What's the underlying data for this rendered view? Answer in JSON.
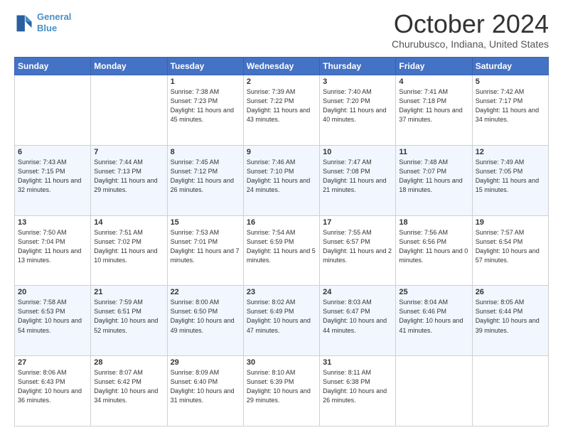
{
  "header": {
    "logo_line1": "General",
    "logo_line2": "Blue",
    "month_title": "October 2024",
    "location": "Churubusco, Indiana, United States"
  },
  "weekdays": [
    "Sunday",
    "Monday",
    "Tuesday",
    "Wednesday",
    "Thursday",
    "Friday",
    "Saturday"
  ],
  "weeks": [
    [
      {
        "day": "",
        "info": ""
      },
      {
        "day": "",
        "info": ""
      },
      {
        "day": "1",
        "info": "Sunrise: 7:38 AM\nSunset: 7:23 PM\nDaylight: 11 hours and 45 minutes."
      },
      {
        "day": "2",
        "info": "Sunrise: 7:39 AM\nSunset: 7:22 PM\nDaylight: 11 hours and 43 minutes."
      },
      {
        "day": "3",
        "info": "Sunrise: 7:40 AM\nSunset: 7:20 PM\nDaylight: 11 hours and 40 minutes."
      },
      {
        "day": "4",
        "info": "Sunrise: 7:41 AM\nSunset: 7:18 PM\nDaylight: 11 hours and 37 minutes."
      },
      {
        "day": "5",
        "info": "Sunrise: 7:42 AM\nSunset: 7:17 PM\nDaylight: 11 hours and 34 minutes."
      }
    ],
    [
      {
        "day": "6",
        "info": "Sunrise: 7:43 AM\nSunset: 7:15 PM\nDaylight: 11 hours and 32 minutes."
      },
      {
        "day": "7",
        "info": "Sunrise: 7:44 AM\nSunset: 7:13 PM\nDaylight: 11 hours and 29 minutes."
      },
      {
        "day": "8",
        "info": "Sunrise: 7:45 AM\nSunset: 7:12 PM\nDaylight: 11 hours and 26 minutes."
      },
      {
        "day": "9",
        "info": "Sunrise: 7:46 AM\nSunset: 7:10 PM\nDaylight: 11 hours and 24 minutes."
      },
      {
        "day": "10",
        "info": "Sunrise: 7:47 AM\nSunset: 7:08 PM\nDaylight: 11 hours and 21 minutes."
      },
      {
        "day": "11",
        "info": "Sunrise: 7:48 AM\nSunset: 7:07 PM\nDaylight: 11 hours and 18 minutes."
      },
      {
        "day": "12",
        "info": "Sunrise: 7:49 AM\nSunset: 7:05 PM\nDaylight: 11 hours and 15 minutes."
      }
    ],
    [
      {
        "day": "13",
        "info": "Sunrise: 7:50 AM\nSunset: 7:04 PM\nDaylight: 11 hours and 13 minutes."
      },
      {
        "day": "14",
        "info": "Sunrise: 7:51 AM\nSunset: 7:02 PM\nDaylight: 11 hours and 10 minutes."
      },
      {
        "day": "15",
        "info": "Sunrise: 7:53 AM\nSunset: 7:01 PM\nDaylight: 11 hours and 7 minutes."
      },
      {
        "day": "16",
        "info": "Sunrise: 7:54 AM\nSunset: 6:59 PM\nDaylight: 11 hours and 5 minutes."
      },
      {
        "day": "17",
        "info": "Sunrise: 7:55 AM\nSunset: 6:57 PM\nDaylight: 11 hours and 2 minutes."
      },
      {
        "day": "18",
        "info": "Sunrise: 7:56 AM\nSunset: 6:56 PM\nDaylight: 11 hours and 0 minutes."
      },
      {
        "day": "19",
        "info": "Sunrise: 7:57 AM\nSunset: 6:54 PM\nDaylight: 10 hours and 57 minutes."
      }
    ],
    [
      {
        "day": "20",
        "info": "Sunrise: 7:58 AM\nSunset: 6:53 PM\nDaylight: 10 hours and 54 minutes."
      },
      {
        "day": "21",
        "info": "Sunrise: 7:59 AM\nSunset: 6:51 PM\nDaylight: 10 hours and 52 minutes."
      },
      {
        "day": "22",
        "info": "Sunrise: 8:00 AM\nSunset: 6:50 PM\nDaylight: 10 hours and 49 minutes."
      },
      {
        "day": "23",
        "info": "Sunrise: 8:02 AM\nSunset: 6:49 PM\nDaylight: 10 hours and 47 minutes."
      },
      {
        "day": "24",
        "info": "Sunrise: 8:03 AM\nSunset: 6:47 PM\nDaylight: 10 hours and 44 minutes."
      },
      {
        "day": "25",
        "info": "Sunrise: 8:04 AM\nSunset: 6:46 PM\nDaylight: 10 hours and 41 minutes."
      },
      {
        "day": "26",
        "info": "Sunrise: 8:05 AM\nSunset: 6:44 PM\nDaylight: 10 hours and 39 minutes."
      }
    ],
    [
      {
        "day": "27",
        "info": "Sunrise: 8:06 AM\nSunset: 6:43 PM\nDaylight: 10 hours and 36 minutes."
      },
      {
        "day": "28",
        "info": "Sunrise: 8:07 AM\nSunset: 6:42 PM\nDaylight: 10 hours and 34 minutes."
      },
      {
        "day": "29",
        "info": "Sunrise: 8:09 AM\nSunset: 6:40 PM\nDaylight: 10 hours and 31 minutes."
      },
      {
        "day": "30",
        "info": "Sunrise: 8:10 AM\nSunset: 6:39 PM\nDaylight: 10 hours and 29 minutes."
      },
      {
        "day": "31",
        "info": "Sunrise: 8:11 AM\nSunset: 6:38 PM\nDaylight: 10 hours and 26 minutes."
      },
      {
        "day": "",
        "info": ""
      },
      {
        "day": "",
        "info": ""
      }
    ]
  ]
}
